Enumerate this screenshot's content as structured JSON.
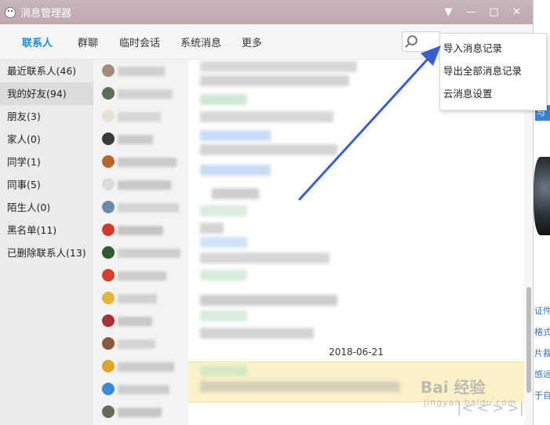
{
  "window": {
    "title": "消息管理器",
    "controls": [
      "▼",
      "—",
      "□",
      "✕"
    ]
  },
  "tabs": [
    {
      "label": "联系人",
      "active": true
    },
    {
      "label": "群聊",
      "active": false
    },
    {
      "label": "临时会话",
      "active": false
    },
    {
      "label": "系统消息",
      "active": false
    },
    {
      "label": "更多",
      "active": false
    }
  ],
  "search": {
    "placeholder": ""
  },
  "groups": [
    {
      "label": "最近联系人(46)"
    },
    {
      "label": "我的好友(94)"
    },
    {
      "label": "朋友(3)"
    },
    {
      "label": "家人(0)"
    },
    {
      "label": "同学(1)"
    },
    {
      "label": "同事(5)"
    },
    {
      "label": "陌生人(0)"
    },
    {
      "label": "黑名单(11)"
    },
    {
      "label": "已删除联系人(13)"
    }
  ],
  "menu": {
    "items": [
      "导入消息记录",
      "导出全部消息记录",
      "云消息设置"
    ]
  },
  "messages": {
    "date_separator": "2018-06-21",
    "nav": [
      "|<",
      "<",
      ">",
      ">|"
    ]
  },
  "background_page": {
    "tab_text": "与我",
    "side_links": [
      "证件",
      "格式",
      "片裁",
      "感远",
      "于自"
    ]
  },
  "watermark": {
    "text": "Bai 经验",
    "sub": "jingyan.baidu.com"
  },
  "colors": {
    "accent": "#1b8ad9",
    "titlebar": "#c3b0b4",
    "arrow": "#3a5fcd"
  }
}
